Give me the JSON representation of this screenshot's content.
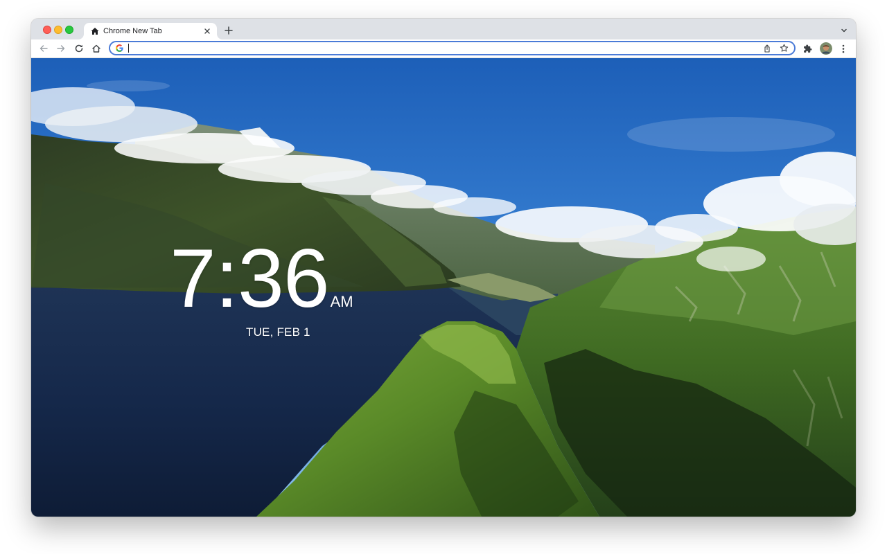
{
  "tab": {
    "title": "Chrome New Tab",
    "favicon": "house-icon"
  },
  "toolbar": {
    "icons": [
      "back-arrow-icon",
      "forward-arrow-icon",
      "reload-icon",
      "home-icon",
      "share-icon",
      "star-icon",
      "extensions-puzzle-icon",
      "kebab-menu-icon",
      "chevron-down-icon"
    ]
  },
  "omnibox": {
    "value": "",
    "search_engine_icon": "google-g-icon"
  },
  "page": {
    "time": "7:36",
    "ampm": "AM",
    "date": "TUE, FEB 1",
    "wallpaper": "fjord-mountain-landscape"
  },
  "colors": {
    "omnibox_focus": "#4b7bd7",
    "tabstrip": "#dee1e6",
    "traffic_close": "#ff5f57",
    "traffic_min": "#febc2e",
    "traffic_max": "#28c840"
  }
}
